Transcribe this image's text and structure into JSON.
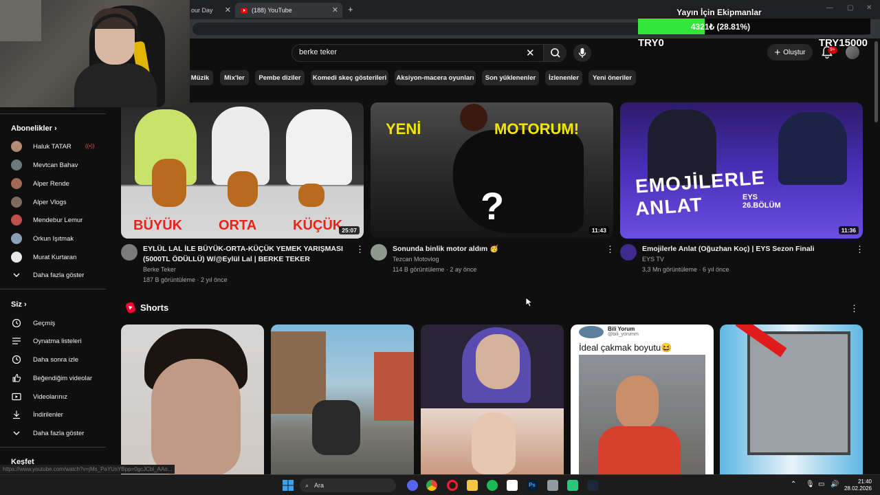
{
  "browser": {
    "tabs": [
      {
        "label": "our Day"
      },
      {
        "label": "(188) YouTube"
      }
    ]
  },
  "goal": {
    "title": "Yayın İçin Ekipmanlar",
    "amount": "4321₺ (28.81%)",
    "progress": 0.2881,
    "min_label": "TRY0",
    "max_label": "TRY15000"
  },
  "header": {
    "search_value": "berke teker",
    "create_label": "Oluştur",
    "notification_badge": "9+"
  },
  "chips": [
    "Müzik",
    "Mix'ler",
    "Pembe diziler",
    "Komedi skeç gösterileri",
    "Aksiyon-macera oyunları",
    "Son yüklenenler",
    "İzlenenler",
    "Yeni öneriler"
  ],
  "sidebar": {
    "subscriptions_title": "Abonelikler",
    "subscriptions": [
      "Haluk TATAR",
      "Mevtcan Bahav",
      "Alper Rende",
      "Alper Vlogs",
      "Mendebur Lemur",
      "Orkun Işıtmak",
      "Murat Kurtaran"
    ],
    "show_more": "Daha fazla göster",
    "you_title": "Siz",
    "you_items": [
      "Geçmiş",
      "Oynatma listeleri",
      "Daha sonra izle",
      "Beğendiğim videolar",
      "Videolarınız",
      "İndirilenler",
      "Daha fazla göster"
    ],
    "explore_title": "Keşfet"
  },
  "videos": [
    {
      "title_line1": "EYLÜL LAL İLE BÜYÜK-ORTA-KÜÇÜK YEMEK YARIŞMASI",
      "title_line2": "(5000TL ÖDÜLLÜ) W/@Eylül Lal | BERKE TEKER",
      "channel": "Berke Teker",
      "meta": "187 B görüntüleme · 2 yıl önce",
      "duration": "25:07",
      "thumb_labels": [
        "BÜYÜK",
        "ORTA",
        "KÜÇÜK"
      ]
    },
    {
      "title_line1": "Sonunda binlik motor aldım 🥳",
      "title_line2": "",
      "channel": "Tezcan Motovlog",
      "meta": "114 B görüntüleme · 2 ay önce",
      "duration": "11:43",
      "thumb_labels": [
        "YENİ",
        "MOTORUM!",
        "?"
      ]
    },
    {
      "title_line1": "Emojilerle Anlat (Oğuzhan Koç) | EYS Sezon Finali",
      "title_line2": "",
      "channel": "EYS TV",
      "meta": "3,3 Mn görüntüleme · 6 yıl önce",
      "duration": "11:36",
      "thumb_labels": [
        "EMOJİLERLE",
        "ANLAT",
        "EYS",
        "26.BÖLÜM"
      ]
    }
  ],
  "shorts": {
    "title": "Shorts",
    "overlay_text": "İdeal çakmak boyutu😆",
    "overlay_channel": "Bili Yorum",
    "overlay_handle": "@bili_yorumm"
  },
  "status_url": "https://www.youtube.com/watch?v=jMs_PaYUsYBpp=0gcJCbl_AAo...",
  "taskbar": {
    "search_label": "Ara",
    "time": "21:40",
    "date": "28.02.2026"
  }
}
